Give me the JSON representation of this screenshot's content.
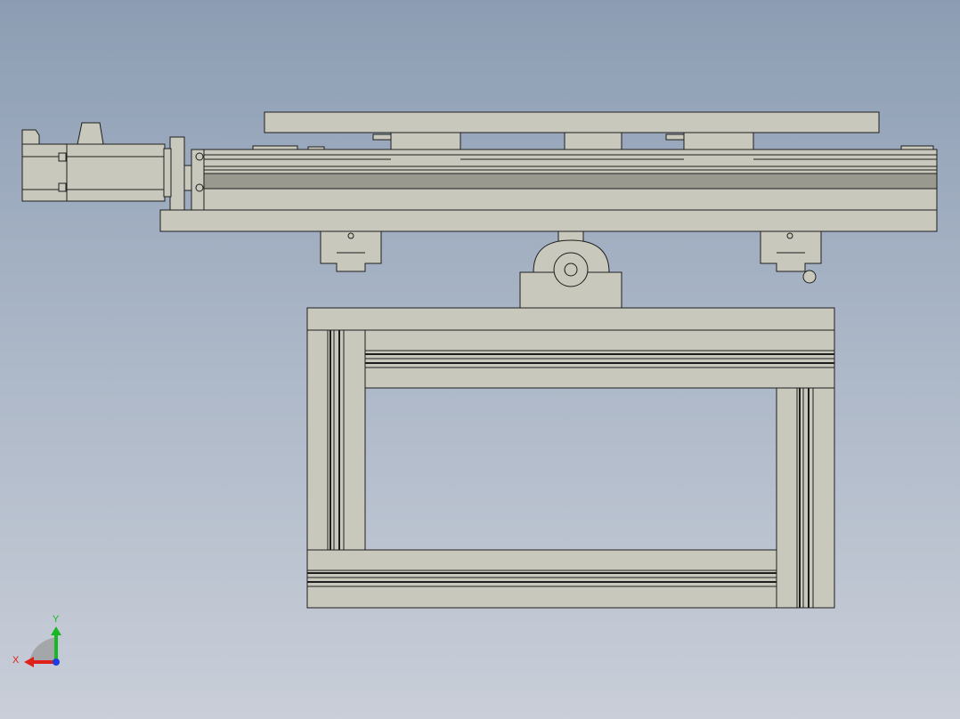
{
  "triad": {
    "x_label": "X",
    "y_label": "Y",
    "colors": {
      "x": "#e0201a",
      "y": "#18b824",
      "z": "#1f3ee0"
    }
  },
  "colors": {
    "background_top": "#8c9db3",
    "background_bottom": "#c9ced8",
    "part_fill": "#c9c8bc",
    "part_dark": "#9a998f",
    "edge": "#1e1e1e"
  }
}
